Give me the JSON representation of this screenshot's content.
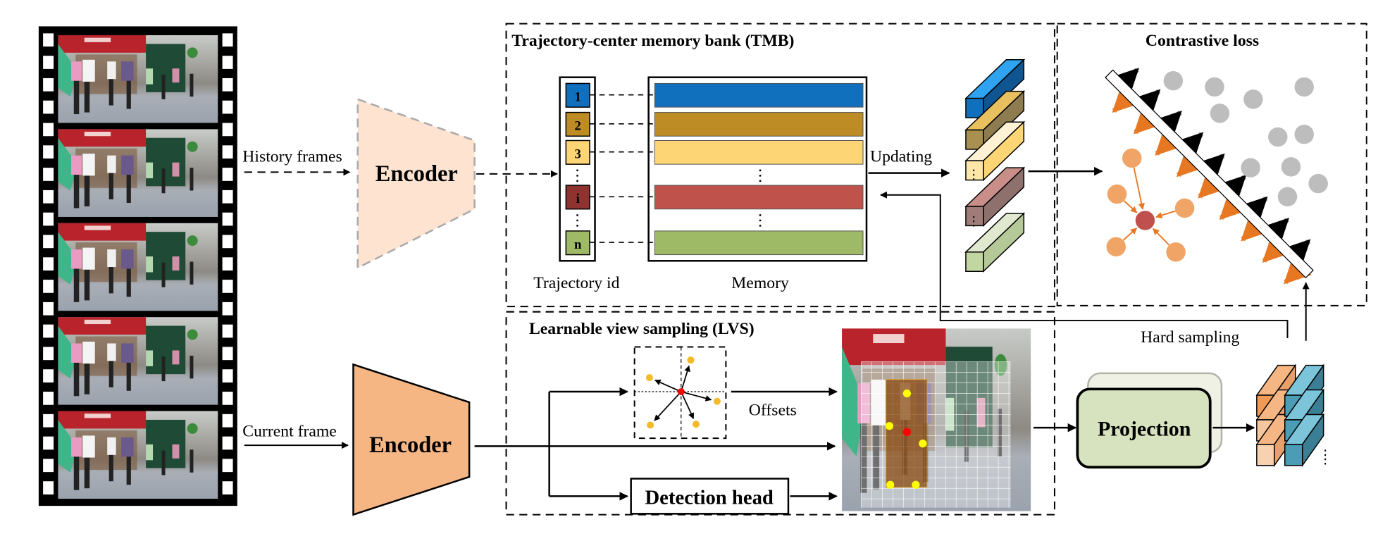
{
  "labels": {
    "history_frames": "History frames",
    "current_frame": "Current frame",
    "encoder_history": "Encoder",
    "encoder_current": "Encoder",
    "tmb_title": "Trajectory-center memory bank (TMB)",
    "contrastive_title": "Contrastive loss",
    "trajectory_id": "Trajectory id",
    "memory": "Memory",
    "updating": "Updating",
    "lvs_title": "Learnable view sampling (LVS)",
    "offsets": "Offsets",
    "detection_head": "Detection head",
    "hard_sampling": "Hard sampling",
    "projection": "Projection"
  },
  "trajectory_ids": [
    {
      "id": "1",
      "color": "#1170bd"
    },
    {
      "id": "2",
      "color": "#be8c25"
    },
    {
      "id": "3",
      "color": "#fdd574"
    },
    {
      "id": "i",
      "color": "#8e332f"
    },
    {
      "id": "n",
      "color": "#9fba66"
    }
  ],
  "memory_colors": [
    "#1170bd",
    "#be8c25",
    "#fdd574",
    "#c0524c",
    "#9fba66"
  ],
  "colors": {
    "encoder_history_fill": "#fde3d0",
    "encoder_current_fill": "#f5b684",
    "projection_fill": "#d7e2bf",
    "positive": "#f0a466",
    "anchor": "#c0504d",
    "negative": "#bdbdbd",
    "sampling_point": "#f6b928",
    "center_point": "#ff0000"
  }
}
